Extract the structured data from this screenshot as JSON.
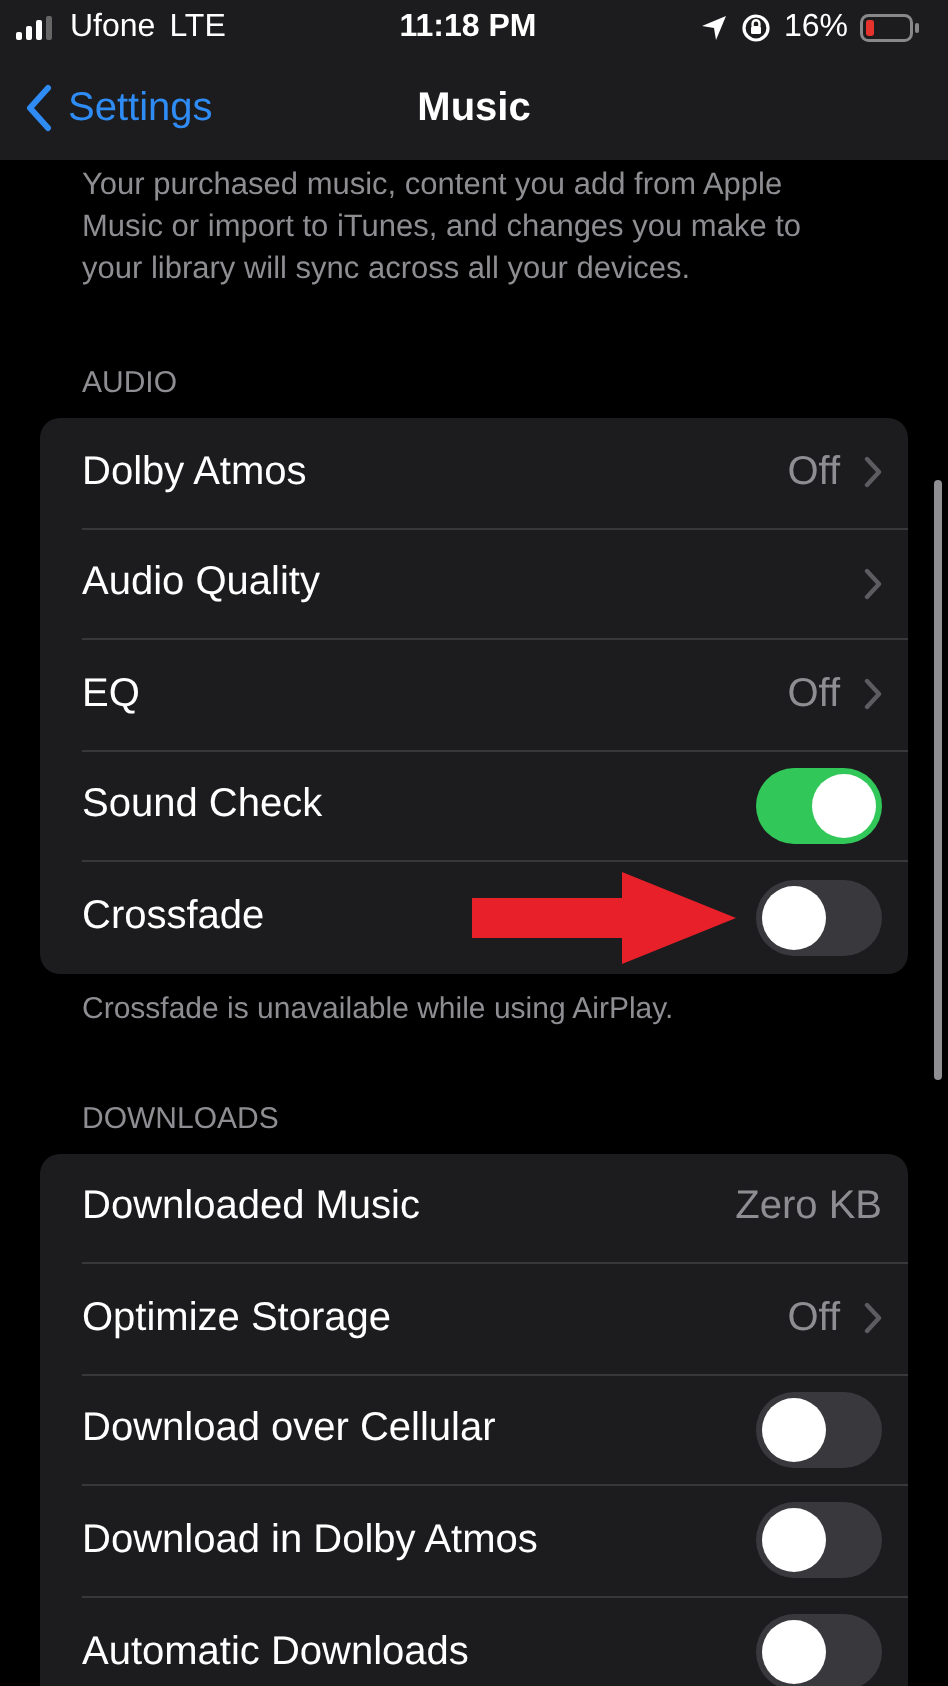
{
  "status_bar": {
    "carrier": "Ufone",
    "network": "LTE",
    "time": "11:18 PM",
    "battery": "16%"
  },
  "nav": {
    "back": "Settings",
    "title": "Music"
  },
  "intro": "Your purchased music, content you add from Apple Music or import to iTunes, and changes you make to your library will sync across all your devices.",
  "sections": [
    {
      "header": "AUDIO",
      "footer": "Crossfade is unavailable while using AirPlay.",
      "rows": [
        {
          "kind": "disclosure",
          "label": "Dolby Atmos",
          "value": "Off"
        },
        {
          "kind": "disclosure",
          "label": "Audio Quality"
        },
        {
          "kind": "disclosure",
          "label": "EQ",
          "value": "Off"
        },
        {
          "kind": "toggle",
          "label": "Sound Check",
          "on": true
        },
        {
          "kind": "toggle",
          "label": "Crossfade",
          "on": false,
          "pointed": true
        }
      ]
    },
    {
      "header": "DOWNLOADS",
      "rows": [
        {
          "kind": "info",
          "label": "Downloaded Music",
          "value": "Zero KB"
        },
        {
          "kind": "disclosure",
          "label": "Optimize Storage",
          "value": "Off"
        },
        {
          "kind": "toggle",
          "label": "Download over Cellular",
          "on": false
        },
        {
          "kind": "toggle",
          "label": "Download in Dolby Atmos",
          "on": false
        },
        {
          "kind": "toggle",
          "label": "Automatic Downloads",
          "on": false
        }
      ]
    }
  ]
}
